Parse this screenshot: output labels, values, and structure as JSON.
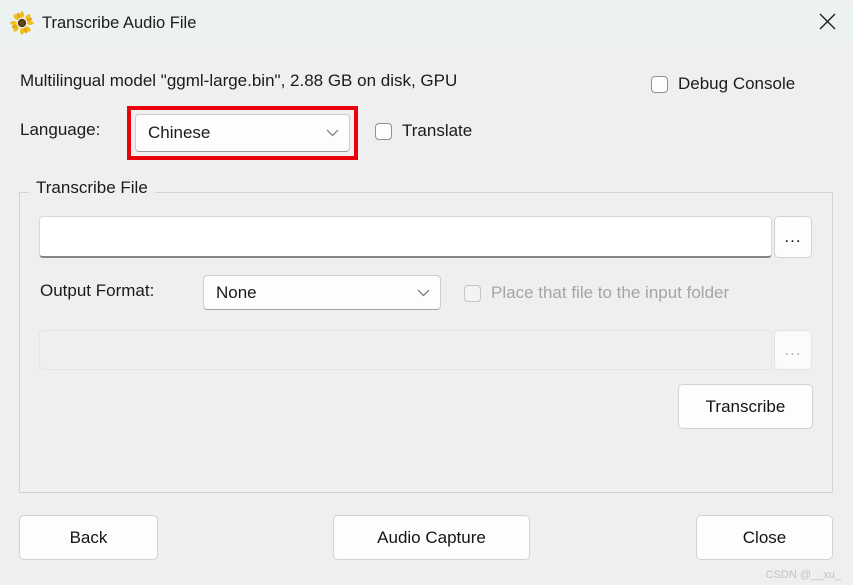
{
  "window": {
    "title": "Transcribe Audio File",
    "app_icon": "sunflower-icon",
    "close_icon": "close-icon",
    "background_color": "#efefef",
    "titlebar_color": "#ecf1f2"
  },
  "header": {
    "model_info": "Multilingual model \"ggml-large.bin\", 2.88 GB on disk, GPU",
    "debug_console": {
      "label": "Debug Console",
      "checked": false
    }
  },
  "language_row": {
    "label": "Language:",
    "dropdown": {
      "selected": "Chinese",
      "chevron_icon": "chevron-down-icon"
    },
    "highlight_color": "#e8000c",
    "translate": {
      "label": "Translate",
      "checked": false
    }
  },
  "transcribe_file": {
    "group_label": "Transcribe File",
    "input_file": {
      "value": "",
      "placeholder": ""
    },
    "browse_button_1": "...",
    "output_format": {
      "label": "Output Format:",
      "selected": "None",
      "chevron_icon": "chevron-down-icon"
    },
    "place_file": {
      "label": "Place that file to the input folder",
      "checked": false,
      "disabled": true
    },
    "output_path": {
      "value": "",
      "disabled": true
    },
    "browse_button_2": "...",
    "transcribe_button": "Transcribe"
  },
  "footer": {
    "back_button": "Back",
    "audio_capture_button": "Audio Capture",
    "close_button": "Close"
  },
  "watermark": "CSDN @__xu_"
}
